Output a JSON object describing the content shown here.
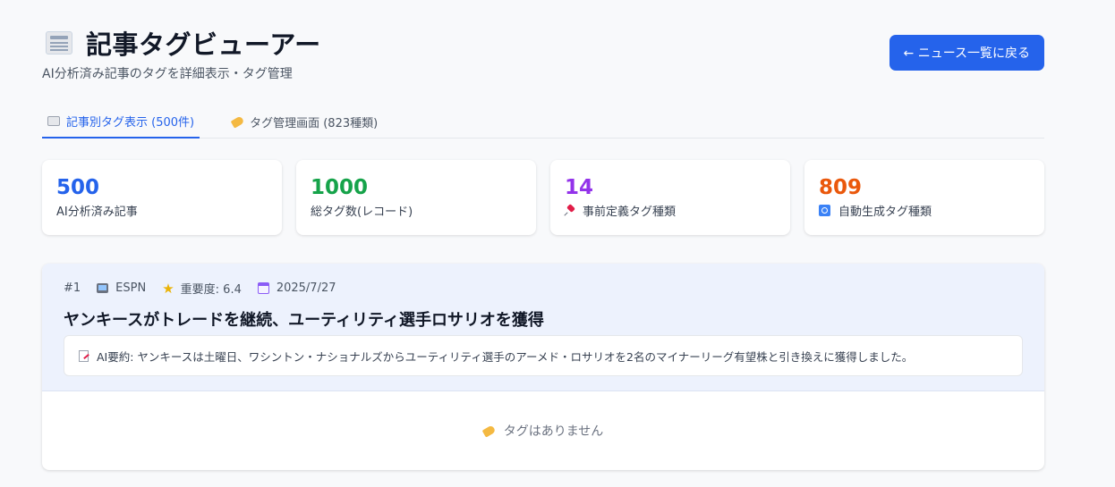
{
  "header": {
    "icon": "newspaper-icon",
    "title": "記事タグビューアー",
    "subtitle": "AI分析済み記事のタグを詳細表示・タグ管理",
    "back_button": "← ニュース一覧に戻る"
  },
  "tabs": [
    {
      "icon": "newspaper-icon",
      "label": "記事別タグ表示 (500件)",
      "active": true
    },
    {
      "icon": "tag-icon",
      "label": "タグ管理画面 (823種類)",
      "active": false
    }
  ],
  "stats": [
    {
      "value": "500",
      "label": "AI分析済み記事",
      "color": "#2563eb"
    },
    {
      "value": "1000",
      "label": "総タグ数(レコード)",
      "color": "#16a34a"
    },
    {
      "value": "14",
      "label": "事前定義タグ種類",
      "icon": "pushpin-icon",
      "color": "#9333ea"
    },
    {
      "value": "809",
      "label": "自動生成タグ種類",
      "icon": "refresh-icon",
      "color": "#ea580c"
    }
  ],
  "article": {
    "index": "#1",
    "source": "ESPN",
    "importance": "重要度: 6.4",
    "date": "2025/7/27",
    "headline": "ヤンキースがトレードを継続、ユーティリティ選手ロサリオを獲得",
    "summary": "AI要約: ヤンキースは土曜日、ワシントン・ナショナルズからユーティリティ選手のアーメド・ロサリオを2名のマイナーリーグ有望株と引き換えに獲得しました。",
    "empty_tags": "タグはありません"
  }
}
